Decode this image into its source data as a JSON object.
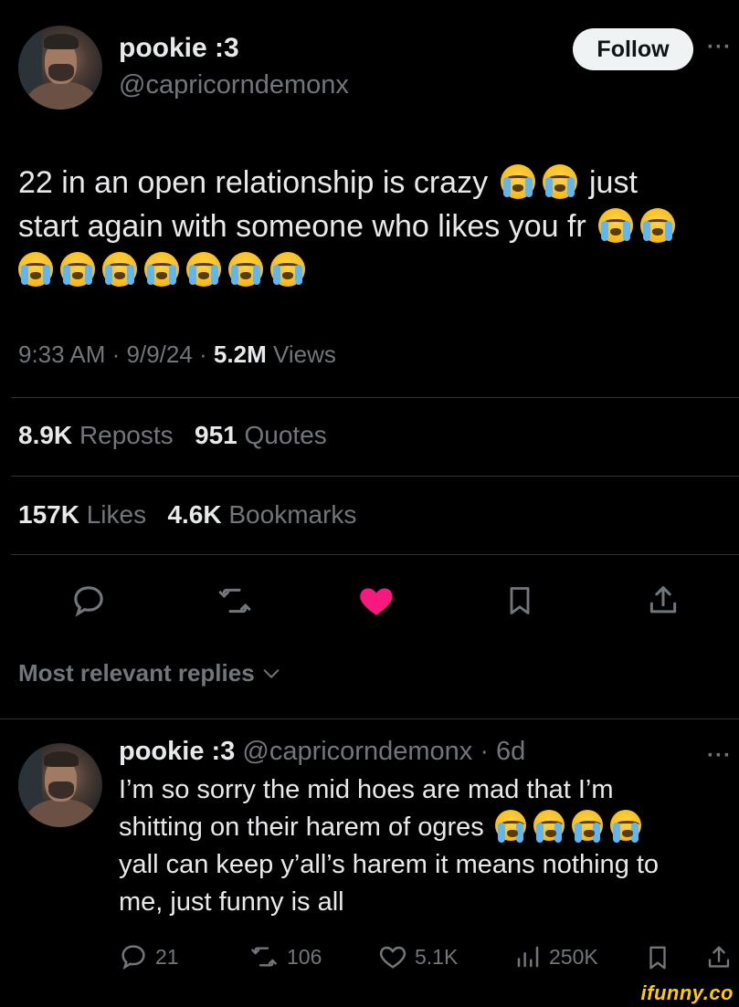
{
  "tweet": {
    "author_name": "pookie :3",
    "author_handle": "@capricorndemonx",
    "follow_label": "Follow",
    "more_label": "···",
    "text_line1": "22 in an open relationship is crazy",
    "text_line1b": "just",
    "text_line2": "start again with someone who likes you fr",
    "time": "9:33 AM",
    "date": "9/9/24",
    "views_count": "5.2M",
    "views_label": "Views",
    "reposts_count": "8.9K",
    "reposts_label": "Reposts",
    "quotes_count": "951",
    "quotes_label": "Quotes",
    "likes_count": "157K",
    "likes_label": "Likes",
    "bookmarks_count": "4.6K",
    "bookmarks_label": "Bookmarks"
  },
  "replies_sort_label": "Most relevant replies",
  "reply": {
    "author_name": "pookie :3",
    "author_handle": "@capricorndemonx",
    "age": "· 6d",
    "more_label": "···",
    "line1": "I’m so sorry the mid hoes are mad that I’m",
    "line2": "shitting on their harem of ogres",
    "line3": "yall can keep y’all’s harem it means nothing to",
    "line4": "me, just funny is all",
    "reply_count": "21",
    "repost_count": "106",
    "like_count": "5.1K",
    "view_count": "250K"
  },
  "watermark": "ifunny.co",
  "colors": {
    "background": "#000000",
    "text": "#e7e9ea",
    "muted": "#71767b",
    "like_active": "#f91880",
    "divider": "#2f3336"
  },
  "icons": [
    "reply-icon",
    "repost-icon",
    "heart-icon",
    "bookmark-icon",
    "share-icon",
    "views-icon",
    "chevron-down-icon",
    "more-icon"
  ]
}
